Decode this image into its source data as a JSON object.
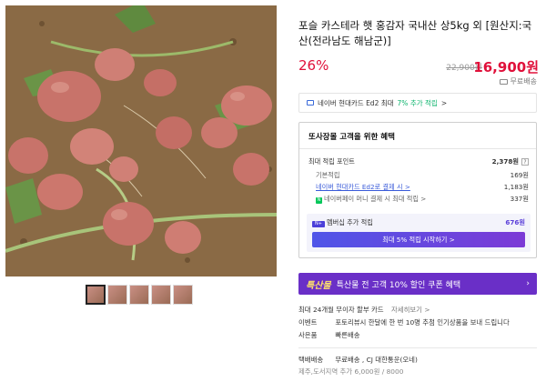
{
  "product": {
    "title": "포슬 카스테라 햇 홍감자 국내산 상5kg 외 [원산지:국산(전라남도 해남군)]",
    "discount": "26%",
    "original_price": "22,900원",
    "final_price": "16,900원",
    "shipping": "무료배송"
  },
  "card_banner": {
    "text_prefix": "네이버 현대카드 Ed2 최대 ",
    "highlight": "7% 추가 적립",
    "suffix": " >"
  },
  "benefits": {
    "title": "또사장몰 고객을 위한 혜택",
    "max_points_label": "최대 적립 포인트",
    "max_points_value": "2,378원",
    "question_mark": "?",
    "rows": [
      {
        "label": "기본적립",
        "value": "169원"
      },
      {
        "label": "네이버 현대카드 Ed2로 결제 시 >",
        "value": "1,183원"
      },
      {
        "label": "네이버페이 머니 결제 시 최대 적립 >",
        "value": "337원"
      }
    ],
    "npay_icon_text": "N",
    "membership": {
      "badge": "N+",
      "label": "멤버십 추가 적립",
      "value": "676원",
      "button": "최대 5% 적립 시작하기 >"
    }
  },
  "coupon": {
    "logo": "특산물",
    "text": "특산물 전 고객 10% 할인 쿠폰 혜택",
    "arrow": "›"
  },
  "payment": {
    "installment": "최대 24개월 무이자 할부 카드",
    "installment_link": "자세히보기 >"
  },
  "event": {
    "key": "이벤트",
    "text": "포토리뷰시 한달에 한 번 10명 추첨 인기상품을 보내 드립니다"
  },
  "gift": {
    "key": "사은품",
    "text": "빠른배송"
  },
  "delivery": {
    "key": "택배배송",
    "text": "무료배송 , CJ 대한통운(오네)",
    "extra": "제주,도서지역 추가 6,000원 / 8000"
  },
  "colors": {
    "price_red": "#e0103a",
    "coupon_purple": "#6a2fc7",
    "naver_green": "#03c75a",
    "member_purple": "#5b3fd9"
  }
}
